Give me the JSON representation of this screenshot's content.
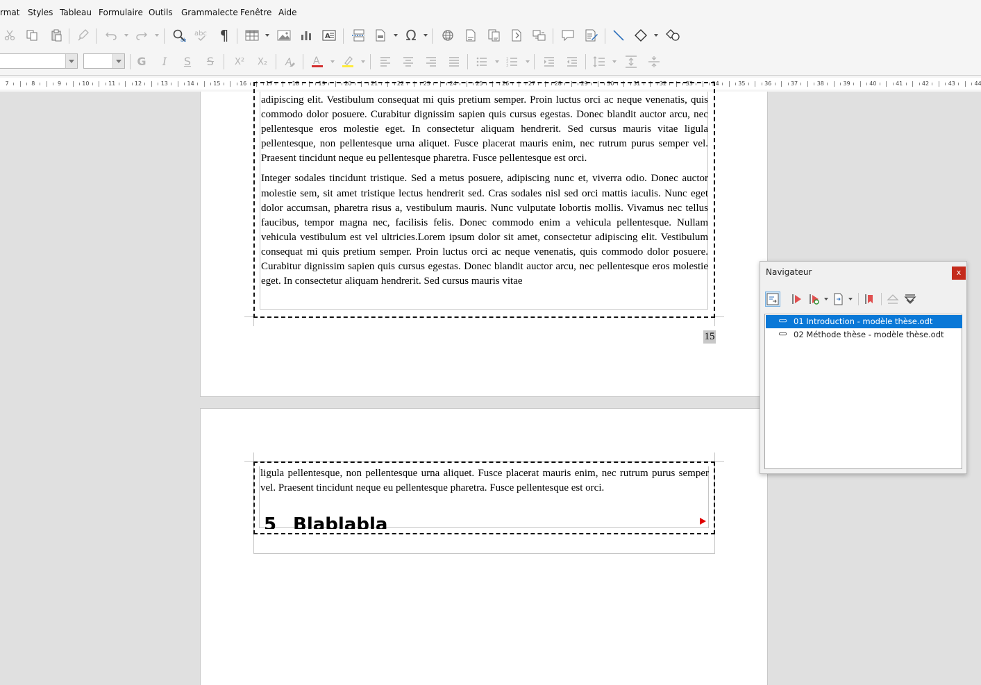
{
  "menu": [
    "rmat",
    "Styles",
    "Tableau",
    "Formulaire",
    "Outils",
    "Grammalecte",
    "Fenêtre",
    "Aide"
  ],
  "toolbar2": {
    "bold_label": "G",
    "italic_label": "I",
    "underline_label": "S",
    "strike_label": "S",
    "superscript_label": "X²",
    "subscript_label": "X₂"
  },
  "ruler": {
    "numbers": [
      "7",
      "8",
      "9",
      "10",
      "11",
      "12",
      "13",
      "14",
      "15",
      "16",
      "17",
      "18",
      "19",
      "20",
      "21",
      "22",
      "23",
      "24",
      "25",
      "26",
      "27",
      "28",
      "29",
      "30",
      "31",
      "32",
      "33",
      "34",
      "35",
      "36",
      "37",
      "38",
      "39",
      "40",
      "41",
      "42",
      "43",
      "44"
    ]
  },
  "document": {
    "page1_para1": "adipiscing elit. Vestibulum consequat mi quis pretium semper. Proin luctus orci ac neque venenatis, quis commodo dolor posuere. Curabitur dignissim sapien quis cursus egestas. Donec blandit auctor arcu, nec pellentesque eros molestie eget. In consectetur aliquam hendrerit. Sed cursus mauris vitae ligula pellentesque, non pellentesque urna aliquet. Fusce placerat mauris enim, nec rutrum purus semper vel. Praesent tincidunt neque eu pellentesque pharetra. Fusce pellentesque est orci.",
    "page1_para2": "Integer sodales tincidunt tristique. Sed a metus posuere, adipiscing nunc et, viverra odio. Donec auctor molestie sem, sit amet tristique lectus hendrerit sed. Cras sodales nisl sed orci mattis iaculis. Nunc eget dolor accumsan, pharetra risus a, vestibulum mauris. Nunc vulputate lobortis mollis. Vivamus nec tellus faucibus, tempor magna nec, facilisis felis. Donec commodo enim a vehicula pellentesque. Nullam vehicula vestibulum est vel ultricies.Lorem ipsum dolor sit amet, consectetur adipiscing elit. Vestibulum consequat mi quis pretium semper. Proin luctus orci ac neque venenatis, quis commodo dolor posuere. Curabitur dignissim sapien quis cursus egestas. Donec blandit auctor arcu, nec pellentesque eros molestie eget. In consectetur aliquam hendrerit. Sed cursus mauris vitae",
    "page_number": "15",
    "page2_para1": "ligula pellentesque, non pellentesque urna aliquet. Fusce placerat mauris enim, nec rutrum purus semper vel. Praesent tincidunt neque eu pellentesque pharetra. Fusce pellentesque est orci.",
    "heading_number": "5",
    "heading_text": "Blablabla"
  },
  "navigator": {
    "title": "Navigateur",
    "close_label": "x",
    "items": [
      {
        "label": "01 Introduction - modèle thèse.odt",
        "selected": true
      },
      {
        "label": "02 Méthode thèse - modèle thèse.odt",
        "selected": false
      }
    ]
  },
  "colors": {
    "selection": "#0a78d7",
    "close_button": "#c42b1c",
    "font_color_bar": "#d32f2f",
    "highlight_bar": "#ffeb3b",
    "redline_marker": "#e00000"
  }
}
